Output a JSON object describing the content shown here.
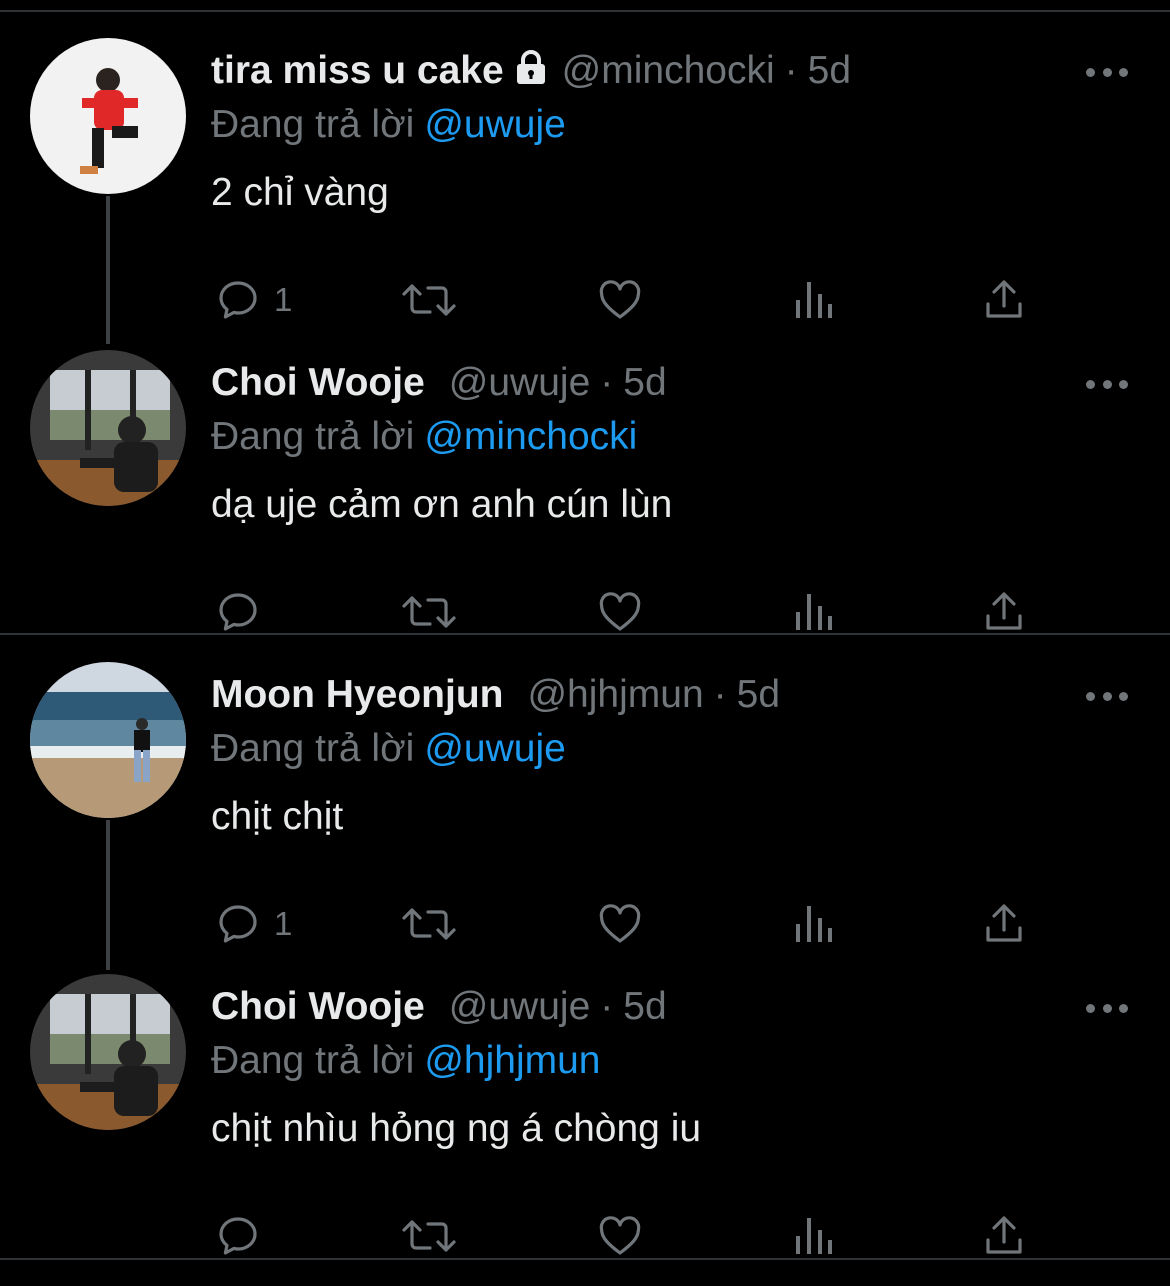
{
  "tweets": [
    {
      "name": "tira miss u cake",
      "locked": true,
      "handle": "@minchocki",
      "time": "5d",
      "reply_prefix": "Đang trả lời",
      "reply_mention": "@uwuje",
      "text": "2 chỉ vàng",
      "reply_count": "1",
      "avatar": "person-red-hoodie"
    },
    {
      "name": "Choi Wooje",
      "locked": false,
      "handle": "@uwuje",
      "time": "5d",
      "reply_prefix": "Đang trả lời",
      "reply_mention": "@minchocki",
      "text": "dạ uje cảm ơn anh cún lùn",
      "reply_count": "",
      "avatar": "person-window-train"
    },
    {
      "name": "Moon Hyeonjun",
      "locked": false,
      "handle": "@hjhjmun",
      "time": "5d",
      "reply_prefix": "Đang trả lời",
      "reply_mention": "@uwuje",
      "text": "chịt chịt",
      "reply_count": "1",
      "avatar": "person-beach"
    },
    {
      "name": "Choi Wooje",
      "locked": false,
      "handle": "@uwuje",
      "time": "5d",
      "reply_prefix": "Đang trả lời",
      "reply_mention": "@hjhjmun",
      "text": "chịt nhìu hỏng ng á chòng iu",
      "reply_count": "",
      "avatar": "person-window-train"
    }
  ],
  "icons": {
    "reply": "reply-bubble-icon",
    "retweet": "retweet-icon",
    "like": "heart-icon",
    "views": "views-bar-chart-icon",
    "share": "share-upload-icon",
    "more": "more-dots-icon",
    "lock": "lock-icon"
  },
  "colors": {
    "background": "#000000",
    "text": "#e7e9ea",
    "muted": "#71767b",
    "link": "#1d9bf0",
    "divider": "#2f3336"
  }
}
